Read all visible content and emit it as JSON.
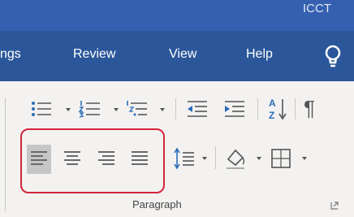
{
  "window": {
    "title_fragment": "ICCT"
  },
  "ribbon_tabs": [
    {
      "label": "ngs"
    },
    {
      "label": "Review"
    },
    {
      "label": "View"
    },
    {
      "label": "Help"
    }
  ],
  "paragraph_group": {
    "label": "Paragraph",
    "row1": [
      "bullets",
      "numbering",
      "multilevel-list",
      "decrease-indent",
      "increase-indent",
      "sort",
      "show-formatting-marks"
    ],
    "row2": [
      "align-left",
      "center",
      "align-right",
      "justify",
      "line-spacing",
      "shading",
      "borders"
    ],
    "selected_alignment": "align-left"
  },
  "sort_glyph": {
    "top": "A",
    "bottom": "Z"
  },
  "pilcrow": "¶",
  "colors": {
    "title_bar": "#3560b0",
    "ribbon_tabs_bar": "#2b579a",
    "ribbon_body": "#f3f2f1",
    "highlight": "#d1263a",
    "icon_blue": "#2b6cb8"
  }
}
